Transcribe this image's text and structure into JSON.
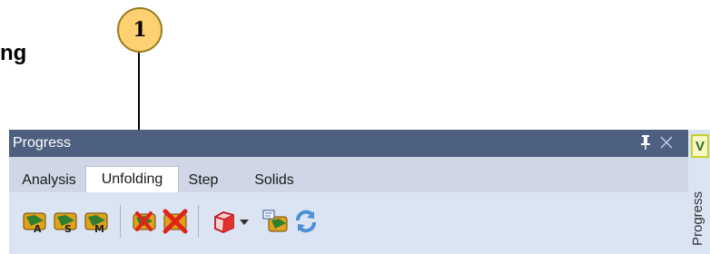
{
  "heading_fragment": "ng",
  "callout": {
    "number": "1"
  },
  "panel": {
    "title": "Progress",
    "tabs": [
      {
        "label": "Analysis",
        "active": false
      },
      {
        "label": "Unfolding",
        "active": true
      },
      {
        "label": "Step",
        "active": false
      },
      {
        "label": "Solids",
        "active": false
      }
    ],
    "toolbar": {
      "icons": [
        "unfold-a-icon",
        "unfold-s-icon",
        "unfold-m-icon",
        "remove-unfold-icon",
        "clear-unfold-icon",
        "solid-box-icon",
        "unfold-settings-icon",
        "refresh-icon"
      ]
    }
  },
  "side_strip": {
    "button_label": "V",
    "tab_label": "Progress"
  },
  "colors": {
    "title_bar": "#4d6082",
    "panel_bg": "#dbe4f3",
    "callout_fill": "#fdd071",
    "side_button_border": "#c7d12a"
  }
}
